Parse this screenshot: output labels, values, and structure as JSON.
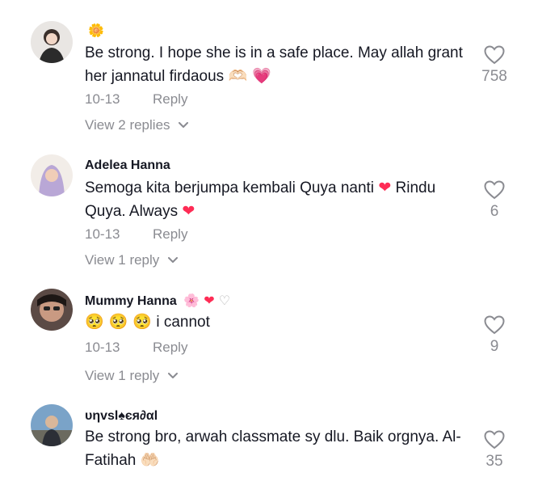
{
  "comments": [
    {
      "username": "🌼",
      "username_emoji": "",
      "text": "Be strong. I hope she is in a safe place. May allah grant her jannatul firdaous",
      "text_emoji": "🫶🏻 💗",
      "date": "10-13",
      "reply_label": "Reply",
      "replies_label": "View 2 replies",
      "likes": "758"
    },
    {
      "username": "Adelea Hanna",
      "username_emoji": "",
      "text_a": "Semoga kita berjumpa kembali Quya nanti",
      "emoji_a": "❤",
      "text_b": "Rindu Quya. Always",
      "emoji_b": "❤",
      "date": "10-13",
      "reply_label": "Reply",
      "replies_label": "View 1 reply",
      "likes": "6"
    },
    {
      "username": "Mummy Hanna",
      "username_emoji": "🌸 ❤ ♡",
      "text_emoji": "🥺 🥺 🥺",
      "text": "i cannot",
      "date": "10-13",
      "reply_label": "Reply",
      "replies_label": "View 1 reply",
      "likes": "9"
    },
    {
      "username": "υηvsl♠єя∂αl",
      "username_emoji": "",
      "text": "Be strong bro, arwah classmate sy dlu. Baik orgnya. Al-Fatihah",
      "text_emoji": "🤲🏻",
      "likes": "35"
    }
  ]
}
